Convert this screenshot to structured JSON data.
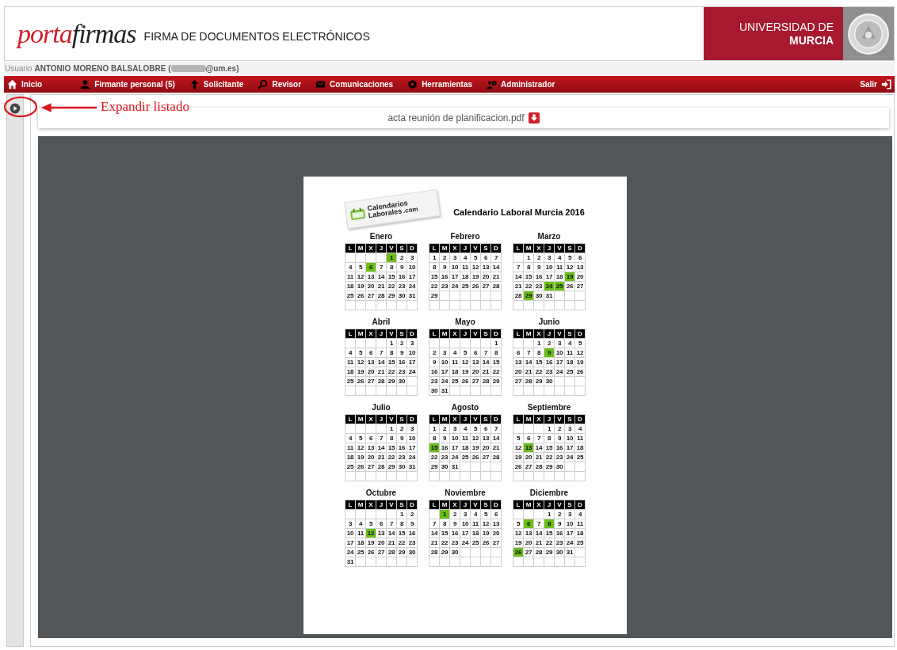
{
  "header": {
    "logo_red": "porta",
    "logo_dark": "firmas",
    "subtitle": "FIRMA DE DOCUMENTOS ELECTRÓNICOS",
    "university": [
      "UNIVERSIDAD DE",
      "MURCIA"
    ]
  },
  "user": {
    "label": "Usuario",
    "name": "ANTONIO MORENO BALSALOBRE (",
    "email_end": "@um.es)"
  },
  "nav": [
    "Inicio",
    "Firmante personal (5)",
    "Solicitante",
    "Revisor",
    "Comunicaciones",
    "Herramientas",
    "Administrador"
  ],
  "logout": "Salir",
  "annotation": "Expandir listado",
  "file": {
    "name": "acta reunión de planificacion.pdf"
  },
  "document": {
    "logo": [
      "Calendarios",
      "Laborales",
      ".com"
    ],
    "title": "Calendario Laboral Murcia 2016",
    "months": [
      {
        "name": "Enero",
        "weekdays": [
          "L",
          "M",
          "X",
          "J",
          "V",
          "S",
          "D"
        ],
        "weeks": [
          [
            {
              "day": "1",
              "holiday": true
            },
            "2",
            "3"
          ],
          [
            "4",
            "5",
            {
              "day": "6",
              "holiday": true
            },
            "7",
            "8",
            "9",
            "10"
          ],
          [
            "11",
            "12",
            "13",
            "14",
            "15",
            "16",
            "17"
          ],
          [
            "18",
            "19",
            "20",
            "21",
            "22",
            "23",
            "24"
          ],
          [
            "25",
            "26",
            "27",
            "28",
            "29",
            "30",
            "31"
          ]
        ]
      },
      {
        "name": "Febrero",
        "weekdays": [
          "L",
          "M",
          "X",
          "J",
          "V",
          "S",
          "D"
        ],
        "weeks": [
          [
            "1",
            "2",
            "3",
            "4",
            "5",
            "6",
            "7"
          ],
          [
            "8",
            "9",
            "10",
            "11",
            "12",
            "13",
            "14"
          ],
          [
            "15",
            "16",
            "17",
            "18",
            "19",
            "20",
            "21"
          ],
          [
            "22",
            "23",
            "24",
            "25",
            "26",
            "27",
            "28"
          ],
          [
            "29"
          ]
        ]
      },
      {
        "name": "Marzo",
        "weekdays": [
          "L",
          "M",
          "X",
          "J",
          "V",
          "S",
          "D"
        ],
        "weeks": [
          [
            "1",
            "2",
            "3",
            "4",
            "5",
            "6"
          ],
          [
            "7",
            "8",
            "9",
            "10",
            "11",
            "12",
            "13"
          ],
          [
            "14",
            "15",
            "16",
            "17",
            "18",
            {
              "day": "19",
              "holiday": true
            },
            "20"
          ],
          [
            "21",
            "22",
            "23",
            {
              "day": "24",
              "holiday": true
            },
            {
              "day": "25",
              "holiday": true
            },
            "26",
            "27"
          ],
          [
            "28",
            {
              "day": "29",
              "holiday": true
            },
            "30",
            "31"
          ]
        ]
      },
      {
        "name": "Abril",
        "weekdays": [
          "L",
          "M",
          "X",
          "J",
          "V",
          "S",
          "D"
        ],
        "weeks": [
          [
            "1",
            "2",
            "3"
          ],
          [
            "4",
            "5",
            "6",
            "7",
            "8",
            "9",
            "10"
          ],
          [
            "11",
            "12",
            "13",
            "14",
            "15",
            "16",
            "17"
          ],
          [
            "18",
            "19",
            "20",
            "21",
            "22",
            "23",
            "24"
          ],
          [
            "25",
            "26",
            "27",
            "28",
            "29",
            "30"
          ]
        ]
      },
      {
        "name": "Mayo",
        "weekdays": [
          "L",
          "M",
          "X",
          "J",
          "V",
          "S",
          "D"
        ],
        "weeks": [
          [
            "1"
          ],
          [
            "2",
            "3",
            "4",
            "5",
            "6",
            "7",
            "8"
          ],
          [
            "9",
            "10",
            "11",
            "12",
            "13",
            "14",
            "15"
          ],
          [
            "16",
            "17",
            "18",
            "19",
            "20",
            "21",
            "22"
          ],
          [
            "23",
            "24",
            "25",
            "26",
            "27",
            "28",
            "29"
          ],
          [
            "30",
            "31"
          ]
        ]
      },
      {
        "name": "Junio",
        "weekdays": [
          "L",
          "M",
          "X",
          "J",
          "V",
          "S",
          "D"
        ],
        "weeks": [
          [
            "1",
            "2",
            "3",
            "4",
            "5"
          ],
          [
            "6",
            "7",
            "8",
            {
              "day": "9",
              "holiday": true
            },
            "10",
            "11",
            "12"
          ],
          [
            "13",
            "14",
            "15",
            "16",
            "17",
            "18",
            "19"
          ],
          [
            "20",
            "21",
            "22",
            "23",
            "24",
            "25",
            "26"
          ],
          [
            "27",
            "28",
            "29",
            "30"
          ]
        ]
      },
      {
        "name": "Julio",
        "weekdays": [
          "L",
          "M",
          "X",
          "J",
          "V",
          "S",
          "D"
        ],
        "weeks": [
          [
            "1",
            "2",
            "3"
          ],
          [
            "4",
            "5",
            "6",
            "7",
            "8",
            "9",
            "10"
          ],
          [
            "11",
            "12",
            "13",
            "14",
            "15",
            "16",
            "17"
          ],
          [
            "18",
            "19",
            "20",
            "21",
            "22",
            "23",
            "24"
          ],
          [
            "25",
            "26",
            "27",
            "28",
            "29",
            "30",
            "31"
          ]
        ]
      },
      {
        "name": "Agosto",
        "weekdays": [
          "L",
          "M",
          "X",
          "J",
          "V",
          "S",
          "D"
        ],
        "weeks": [
          [
            "1",
            "2",
            "3",
            "4",
            "5",
            "6",
            "7"
          ],
          [
            "8",
            "9",
            "10",
            "11",
            "12",
            "13",
            "14"
          ],
          [
            {
              "day": "15",
              "holiday": true
            },
            "16",
            "17",
            "18",
            "19",
            "20",
            "21"
          ],
          [
            "22",
            "23",
            "24",
            "25",
            "26",
            "27",
            "28"
          ],
          [
            "29",
            "30",
            "31"
          ]
        ]
      },
      {
        "name": "Septiembre",
        "weekdays": [
          "L",
          "M",
          "X",
          "J",
          "V",
          "S",
          "D"
        ],
        "weeks": [
          [
            "1",
            "2",
            "3",
            "4"
          ],
          [
            "5",
            "6",
            "7",
            "8",
            "9",
            "10",
            "11"
          ],
          [
            "12",
            {
              "day": "13",
              "holiday": true
            },
            "14",
            "15",
            "16",
            "17",
            "18"
          ],
          [
            "19",
            "20",
            "21",
            "22",
            "23",
            "24",
            "25"
          ],
          [
            "26",
            "27",
            "28",
            "29",
            "30"
          ]
        ]
      },
      {
        "name": "Octubre",
        "weekdays": [
          "L",
          "M",
          "X",
          "J",
          "V",
          "S",
          "D"
        ],
        "weeks": [
          [
            "1",
            "2"
          ],
          [
            "3",
            "4",
            "5",
            "6",
            "7",
            "8",
            "9"
          ],
          [
            "10",
            "11",
            {
              "day": "12",
              "holiday": true
            },
            "13",
            "14",
            "15",
            "16"
          ],
          [
            "17",
            "18",
            "19",
            "20",
            "21",
            "22",
            "23"
          ],
          [
            "24",
            "25",
            "26",
            "27",
            "28",
            "29",
            "30"
          ],
          [
            "31"
          ]
        ]
      },
      {
        "name": "Noviembre",
        "weekdays": [
          "L",
          "M",
          "X",
          "J",
          "V",
          "S",
          "D"
        ],
        "weeks": [
          [
            {
              "day": "1",
              "holiday": true
            },
            "2",
            "3",
            "4",
            "5",
            "6"
          ],
          [
            "7",
            "8",
            "9",
            "10",
            "11",
            "12",
            "13"
          ],
          [
            "14",
            "15",
            "16",
            "17",
            "18",
            "19",
            "20"
          ],
          [
            "21",
            "22",
            "23",
            "24",
            "25",
            "26",
            "27"
          ],
          [
            "28",
            "29",
            "30"
          ]
        ]
      },
      {
        "name": "Diciembre",
        "weekdays": [
          "L",
          "M",
          "X",
          "J",
          "V",
          "S",
          "D"
        ],
        "weeks": [
          [
            "1",
            "2",
            "3",
            "4"
          ],
          [
            "5",
            {
              "day": "6",
              "holiday": true
            },
            "7",
            {
              "day": "8",
              "holiday": true
            },
            "9",
            "10",
            "11"
          ],
          [
            "12",
            "13",
            "14",
            "15",
            "16",
            "17",
            "18"
          ],
          [
            "19",
            "20",
            "21",
            "22",
            "23",
            "24",
            "25"
          ],
          [
            {
              "day": "26",
              "holiday": true
            },
            "27",
            "28",
            "29",
            "30",
            "31"
          ]
        ]
      }
    ]
  }
}
